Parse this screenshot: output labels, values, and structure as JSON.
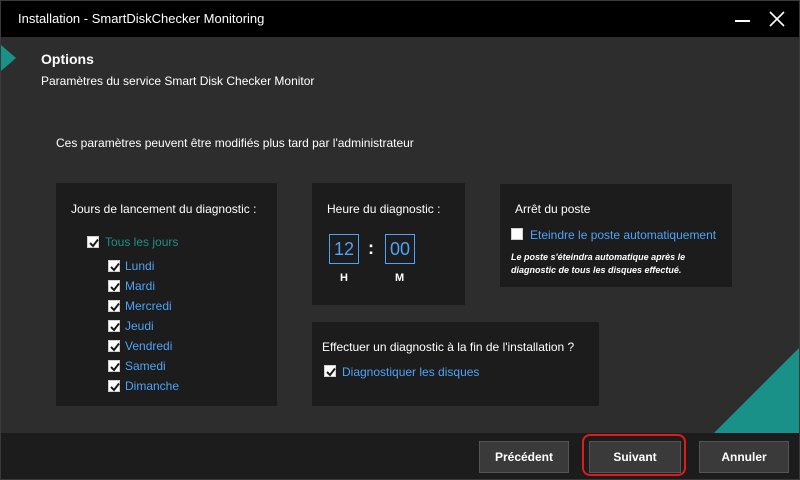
{
  "window": {
    "title": "Installation - SmartDiskChecker Monitoring"
  },
  "header": {
    "title": "Options",
    "subtitle": "Paramètres du service Smart Disk Checker Monitor"
  },
  "intro": "Ces paramètres peuvent être modifiés plus tard par l'administrateur",
  "days_panel": {
    "title": "Jours de lancement du diagnostic :",
    "all_days": {
      "label": "Tous les jours",
      "checked": true
    },
    "days": [
      {
        "label": "Lundi",
        "checked": true
      },
      {
        "label": "Mardi",
        "checked": true
      },
      {
        "label": "Mercredi",
        "checked": true
      },
      {
        "label": "Jeudi",
        "checked": true
      },
      {
        "label": "Vendredi",
        "checked": true
      },
      {
        "label": "Samedi",
        "checked": true
      },
      {
        "label": "Dimanche",
        "checked": true
      }
    ]
  },
  "time_panel": {
    "title": "Heure du diagnostic :",
    "hour": "12",
    "separator": ":",
    "minute": "00",
    "hour_unit": "H",
    "minute_unit": "M"
  },
  "shutdown_panel": {
    "title": "Arrêt du poste",
    "checkbox_label": "Eteindre le poste automatiquement",
    "checked": false,
    "note": "Le poste s'éteindra automatique après le diagnostic de tous les disques effectué."
  },
  "diag_panel": {
    "title": "Effectuer un diagnostic à la fin de l'installation ?",
    "checkbox_label": "Diagnostiquer les disques",
    "checked": true
  },
  "buttons": {
    "previous": "Précédent",
    "next": "Suivant",
    "cancel": "Annuler"
  },
  "colors": {
    "accent": "#1a9188",
    "link_blue": "#4da3f7",
    "highlight": "#e01b1b",
    "panel": "#1c1c1c",
    "background": "#2d2d2d"
  },
  "icons": {
    "minimize": "minimize-icon",
    "close": "close-icon",
    "checkbox": "checkmark-icon"
  }
}
